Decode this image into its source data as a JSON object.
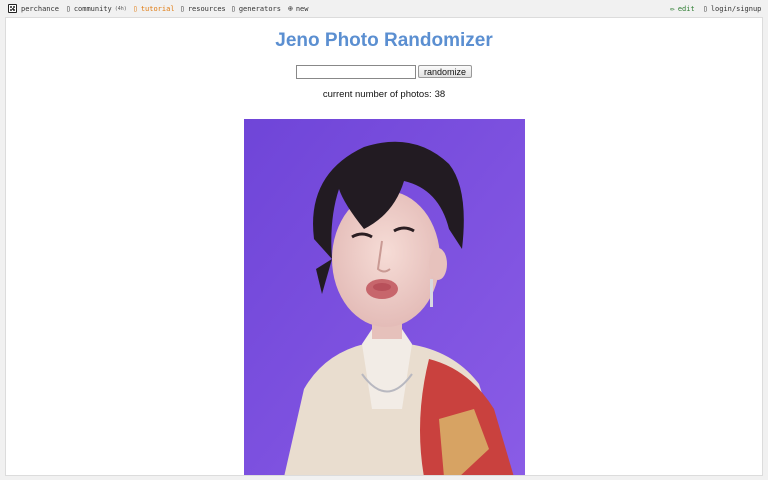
{
  "nav": {
    "perchance": "perchance",
    "community": "community",
    "community_badge": "(4h)",
    "tutorial": "tutorial",
    "resources": "resources",
    "generators": "generators",
    "new": "new",
    "edit": "edit",
    "login": "login/signup"
  },
  "main": {
    "title": "Jeno Photo Randomizer",
    "input_value": "",
    "button_label": "randomize",
    "count_label": "current number of photos:",
    "count_value": "38"
  },
  "colors": {
    "title": "#5b8fd1",
    "tutorial": "#e07a10",
    "edit": "#2e7d32",
    "photo_background": "#7b4fdc"
  }
}
